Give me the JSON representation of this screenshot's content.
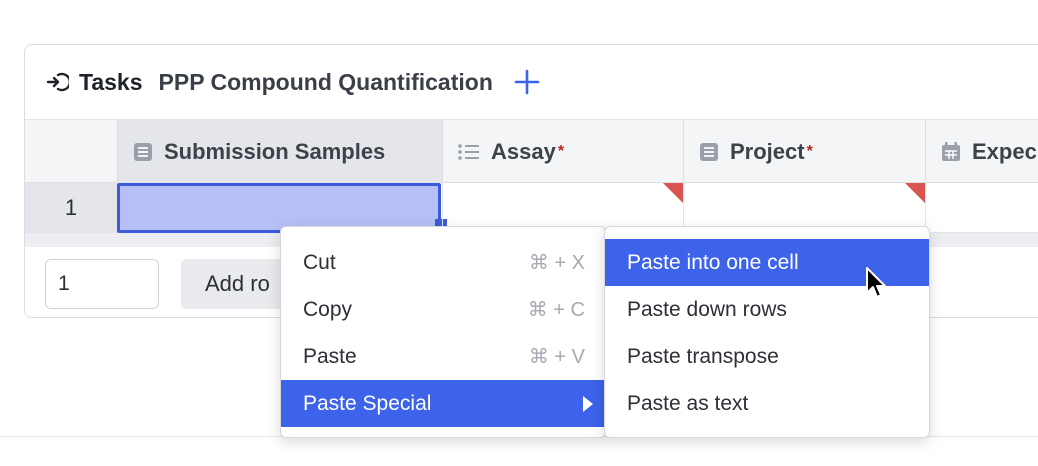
{
  "panel": {
    "tasks_label": "Tasks",
    "title": "PPP Compound Quantification",
    "icons": {
      "tasks": "arrow-into-bracket-icon",
      "add": "plus-icon"
    }
  },
  "columns": [
    {
      "label": "Submission Samples",
      "icon": "table-icon",
      "required": false
    },
    {
      "label": "Assay",
      "icon": "list-icon",
      "required": true
    },
    {
      "label": "Project",
      "icon": "table-icon",
      "required": true
    },
    {
      "label": "Expec",
      "icon": "calendar-icon",
      "required": false
    }
  ],
  "required_marker": "*",
  "rows": [
    {
      "number": "1"
    }
  ],
  "footer": {
    "row_count_value": "1",
    "add_rows_label": "Add ro"
  },
  "context_menu": {
    "items": [
      {
        "label": "Cut",
        "shortcut": "⌘ + X"
      },
      {
        "label": "Copy",
        "shortcut": "⌘ + C"
      },
      {
        "label": "Paste",
        "shortcut": "⌘ + V"
      },
      {
        "label": "Paste Special",
        "has_submenu": true,
        "active": true
      }
    ]
  },
  "paste_special_menu": {
    "items": [
      {
        "label": "Paste into one cell",
        "active": true
      },
      {
        "label": "Paste down rows"
      },
      {
        "label": "Paste transpose"
      },
      {
        "label": "Paste as text"
      }
    ]
  },
  "colors": {
    "accent": "#3d63ea",
    "selected_cell_fill": "#b6c0f6",
    "selected_cell_border": "#3b5bdb",
    "required_marker": "#d9534f"
  }
}
